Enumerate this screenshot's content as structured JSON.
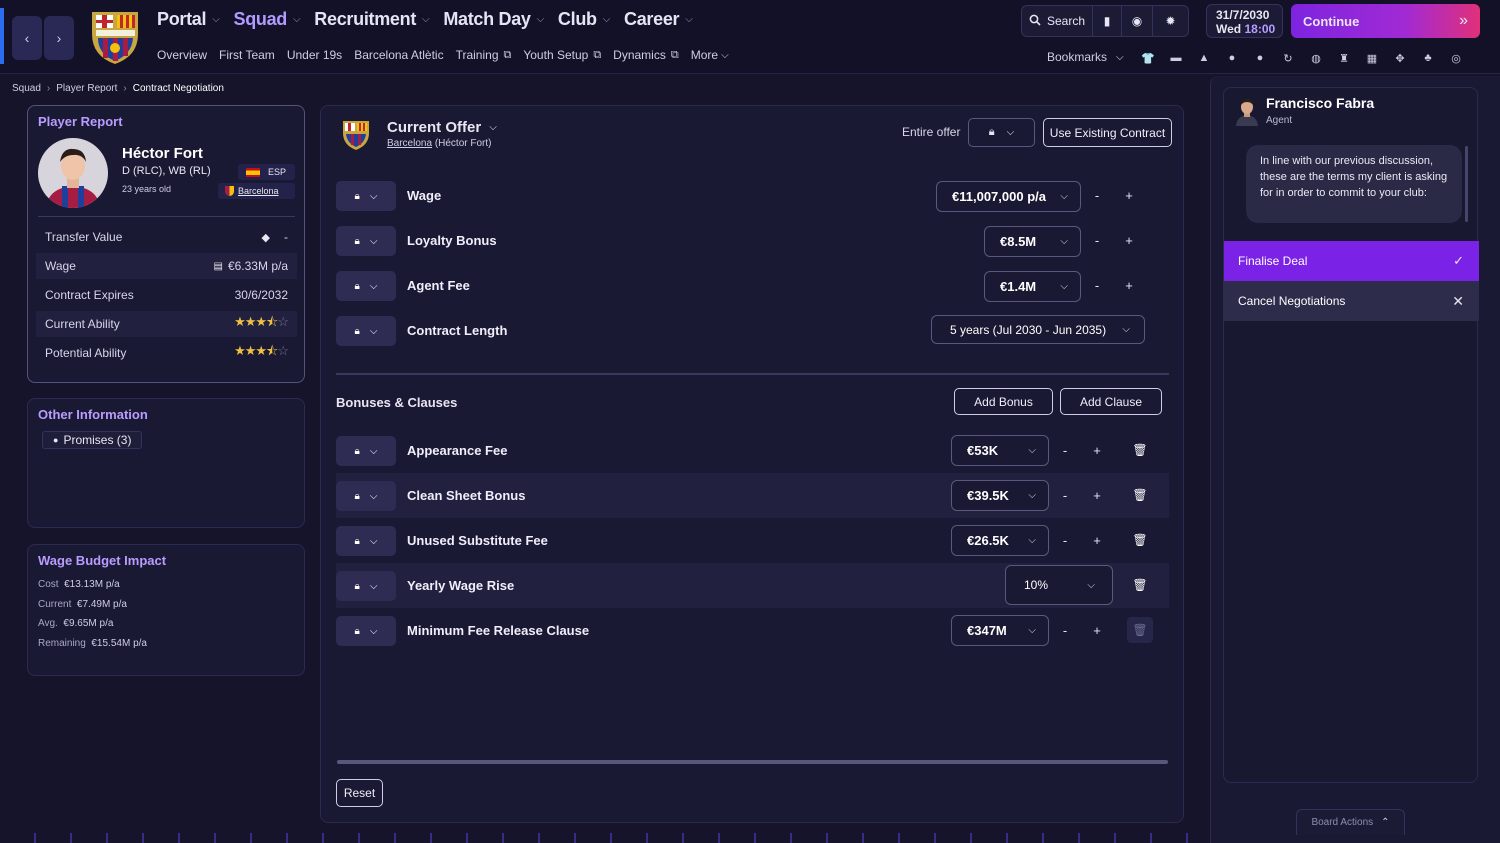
{
  "nav": {
    "main": [
      "Portal",
      "Squad",
      "Recruitment",
      "Match Day",
      "Club",
      "Career"
    ],
    "active": "Squad",
    "sub": [
      "Overview",
      "First Team",
      "Under 19s",
      "Barcelona Atlètic",
      "Training",
      "Youth Setup",
      "Dynamics",
      "More"
    ],
    "search_label": "Search",
    "bookmarks_label": "Bookmarks",
    "date": "31/7/2030",
    "day": "Wed",
    "time": "18:00",
    "continue_label": "Continue",
    "accent": "#8a2be2"
  },
  "breadcrumb": [
    "Squad",
    "Player Report",
    "Contract Negotiation"
  ],
  "player_card": {
    "header": "Player Report",
    "name": "Héctor Fort",
    "position": "D (RLC), WB (RL)",
    "age": "23 years old",
    "nationality": "ESP",
    "club": "Barcelona",
    "rows": [
      {
        "label": "Transfer Value",
        "value": "-"
      },
      {
        "label": "Wage",
        "value": "€6.33M p/a"
      },
      {
        "label": "Contract Expires",
        "value": "30/6/2032"
      },
      {
        "label": "Current Ability",
        "stars": 3.5
      },
      {
        "label": "Potential Ability",
        "stars": 3.5
      }
    ]
  },
  "other_info": {
    "title": "Other Information",
    "promises": "Promises (3)"
  },
  "wage_budget": {
    "title": "Wage Budget Impact",
    "rows": [
      {
        "label": "Cost",
        "value": "€13.13M p/a"
      },
      {
        "label": "Current",
        "value": "€7.49M p/a"
      },
      {
        "label": "Avg.",
        "value": "€9.65M p/a"
      },
      {
        "label": "Remaining",
        "value": "€15.54M p/a"
      }
    ]
  },
  "offer": {
    "title": "Current Offer",
    "club": "Barcelona",
    "player": "(Héctor Fort)",
    "entire_offer_label": "Entire offer",
    "use_existing_label": "Use Existing Contract",
    "terms": [
      {
        "label": "Wage",
        "value": "€11,007,000 p/a"
      },
      {
        "label": "Loyalty Bonus",
        "value": "€8.5M"
      },
      {
        "label": "Agent Fee",
        "value": "€1.4M"
      },
      {
        "label": "Contract Length",
        "value": "5 years (Jul 2030 - Jun 2035)"
      }
    ],
    "bonuses_title": "Bonuses & Clauses",
    "add_bonus_label": "Add Bonus",
    "add_clause_label": "Add Clause",
    "bonuses": [
      {
        "label": "Appearance Fee",
        "value": "€53K"
      },
      {
        "label": "Clean Sheet Bonus",
        "value": "€39.5K"
      },
      {
        "label": "Unused Substitute Fee",
        "value": "€26.5K"
      },
      {
        "label": "Yearly Wage Rise",
        "value": "10%"
      },
      {
        "label": "Minimum Fee Release Clause",
        "value": "€347M"
      }
    ],
    "reset_label": "Reset"
  },
  "agent": {
    "name": "Francisco Fabra",
    "role": "Agent",
    "message": "In line with our previous discussion, these are the terms my client is asking for in order to commit to your club:",
    "finalise_label": "Finalise Deal",
    "cancel_label": "Cancel Negotiations",
    "board_actions_label": "Board Actions"
  },
  "icons": {
    "back": "chevron-left-icon",
    "forward": "chevron-right-icon",
    "search": "search-icon",
    "lock": "lock-icon",
    "trash": "trash-icon",
    "check": "check-icon",
    "close": "close-icon"
  }
}
